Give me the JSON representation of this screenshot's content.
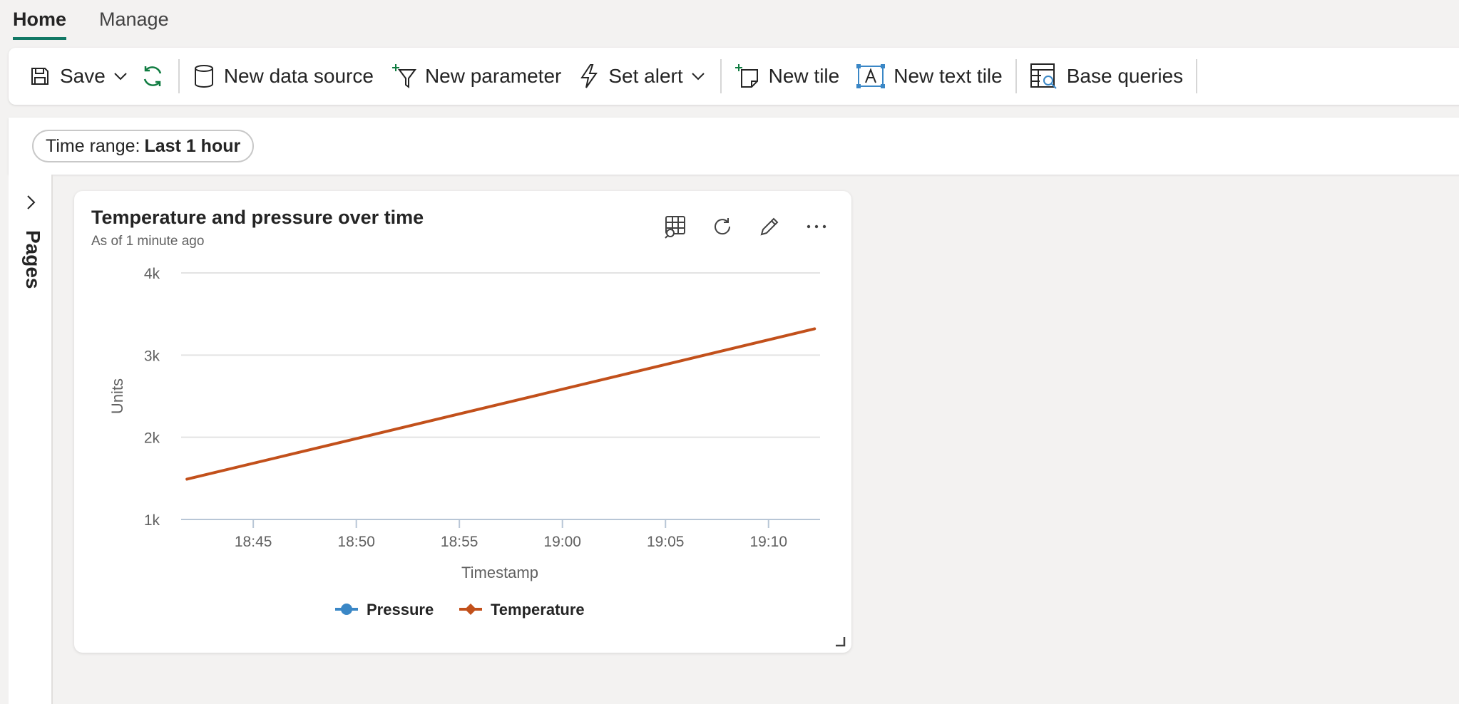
{
  "tabs": [
    {
      "label": "Home",
      "active": true
    },
    {
      "label": "Manage",
      "active": false
    }
  ],
  "ribbon": {
    "save_label": "Save",
    "new_data_source_label": "New data source",
    "new_parameter_label": "New parameter",
    "set_alert_label": "Set alert",
    "new_tile_label": "New tile",
    "new_text_tile_label": "New text tile",
    "base_queries_label": "Base queries"
  },
  "filter": {
    "label": "Time range:",
    "value": "Last 1 hour"
  },
  "rail": {
    "pages_label": "Pages"
  },
  "tile": {
    "title": "Temperature and pressure over time",
    "subtitle": "As of 1 minute ago"
  },
  "colors": {
    "accent": "#117865",
    "refresh": "#107c41",
    "pressure": "#3a87c6",
    "temperature": "#c2501b"
  },
  "chart_data": {
    "type": "line",
    "title": "Temperature and pressure over time",
    "xlabel": "Timestamp",
    "ylabel": "Units",
    "xlim": [
      "18:41:30",
      "19:12:30"
    ],
    "ylim": [
      1000,
      4000
    ],
    "x_ticks": [
      "18:45",
      "18:50",
      "18:55",
      "19:00",
      "19:05",
      "19:10"
    ],
    "y_ticks": [
      "1k",
      "2k",
      "3k",
      "4k"
    ],
    "y_tick_values": [
      1000,
      2000,
      3000,
      4000
    ],
    "grid": true,
    "legend": "bottom",
    "series": [
      {
        "name": "Pressure",
        "color": "#3a87c6",
        "marker": "circle",
        "x": [],
        "y": []
      },
      {
        "name": "Temperature",
        "color": "#c2501b",
        "marker": "diamond",
        "x": [
          "18:41:47",
          "19:12:14"
        ],
        "y": [
          1490,
          3320
        ]
      }
    ]
  }
}
